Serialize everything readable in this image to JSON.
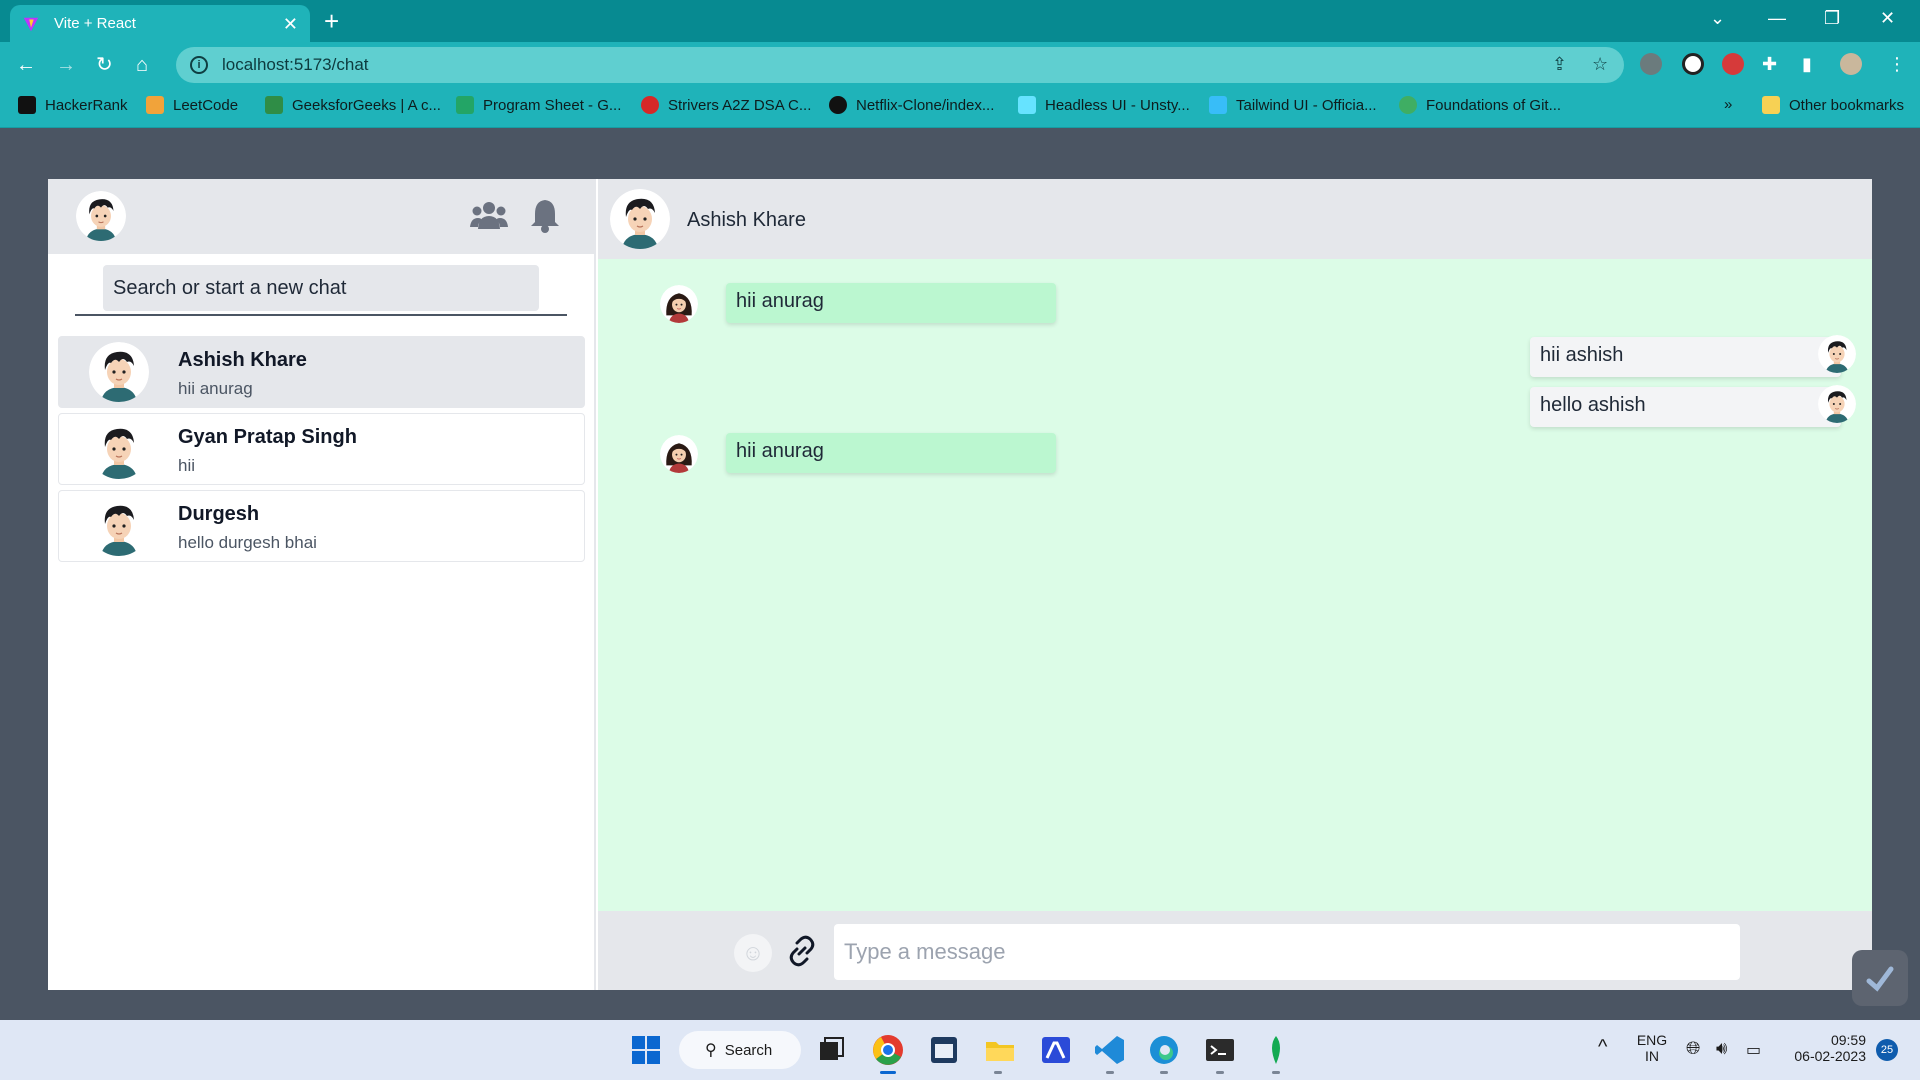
{
  "browser": {
    "tab_title": "Vite + React",
    "url": "localhost:5173/chat",
    "bookmarks": [
      "HackerRank",
      "LeetCode",
      "GeeksforGeeks | A c...",
      "Program Sheet - G...",
      "Strivers A2Z DSA C...",
      "Netflix-Clone/index...",
      "Headless UI - Unsty...",
      "Tailwind UI - Officia...",
      "Foundations of Git..."
    ],
    "bookmarks_overflow": "»",
    "other_bookmarks": "Other bookmarks"
  },
  "sidebar": {
    "search_placeholder": "Search or start a new chat",
    "chats": [
      {
        "name": "Ashish Khare",
        "last_message": "hii anurag",
        "active": true
      },
      {
        "name": "Gyan Pratap Singh",
        "last_message": "hii",
        "active": false
      },
      {
        "name": "Durgesh",
        "last_message": "hello durgesh bhai",
        "active": false
      }
    ]
  },
  "chat": {
    "contact_name": "Ashish Khare",
    "messages": [
      {
        "text": "hii anurag",
        "direction": "incoming"
      },
      {
        "text": "hii ashish",
        "direction": "outgoing"
      },
      {
        "text": "hello ashish",
        "direction": "outgoing"
      },
      {
        "text": "hii anurag",
        "direction": "incoming"
      }
    ],
    "input_placeholder": "Type a message"
  },
  "taskbar": {
    "search_label": "Search",
    "lang_top": "ENG",
    "lang_bottom": "IN",
    "time": "09:59",
    "date": "06-02-2023",
    "notifications": "25"
  },
  "colors": {
    "tab_strip": "#078a91",
    "toolbar": "#1fb3b9",
    "page_bg": "#4b5563",
    "chat_bg": "#dcfce7",
    "incoming_bubble": "#bbf7d0",
    "outgoing_bubble": "#f3f4f6",
    "header_gray": "#e5e7eb"
  }
}
